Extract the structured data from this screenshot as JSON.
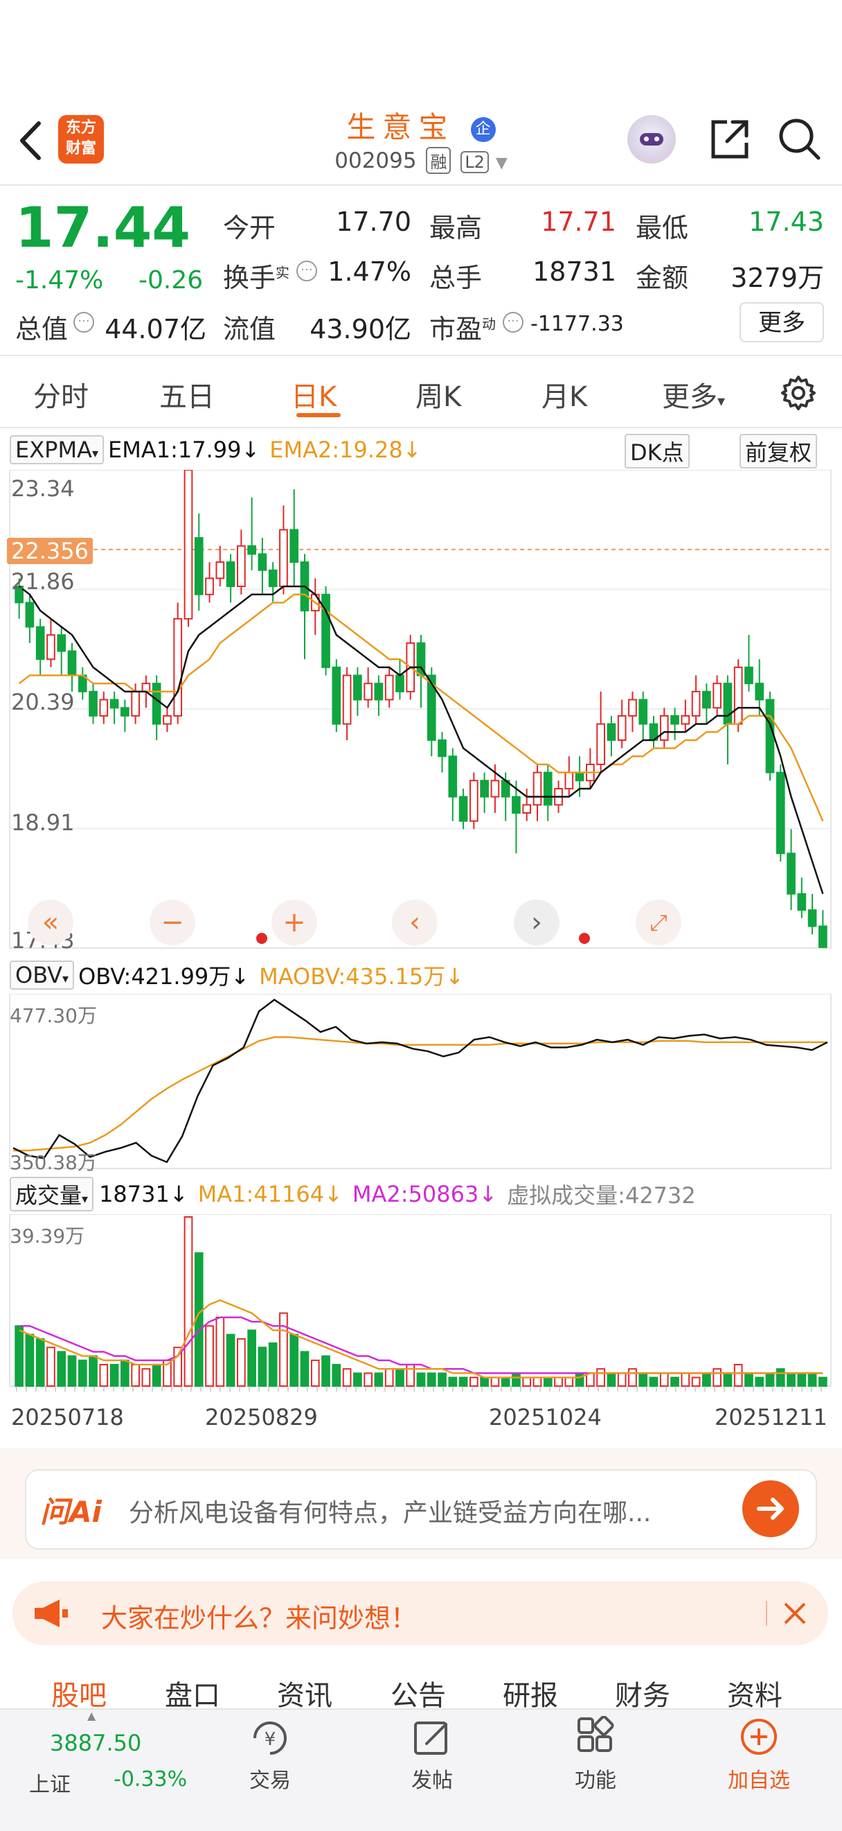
{
  "header": {
    "name": "生意宝",
    "code": "002095",
    "tags": [
      "融",
      "L2"
    ],
    "badge": "企",
    "logo_line1": "东方",
    "logo_line2": "财富"
  },
  "quote": {
    "price": "17.44",
    "change_pct": "-1.47%",
    "change": "-0.26",
    "open_label": "今开",
    "open": "17.70",
    "high_label": "最高",
    "high": "17.71",
    "low_label": "最低",
    "low": "17.43",
    "turnover_label": "换手",
    "turnover_sup": "实",
    "turnover": "1.47%",
    "volume_label": "总手",
    "volume": "18731",
    "amount_label": "金额",
    "amount": "3279万",
    "mktcap_label": "总值",
    "mktcap": "44.07亿",
    "float_label": "流值",
    "float": "43.90亿",
    "pe_label": "市盈",
    "pe_sup": "动",
    "pe": "-1177.33",
    "more": "更多"
  },
  "tabs": [
    "分时",
    "五日",
    "日K",
    "周K",
    "月K",
    "更多"
  ],
  "active_tab": "日K",
  "main_indicator": {
    "name": "EXPMA",
    "ema1": "EMA1:17.99↓",
    "ema2": "EMA2:19.28↓",
    "dk": "DK点",
    "fq": "前复权",
    "y_ticks": [
      "23.34",
      "21.86",
      "20.39",
      "18.91",
      "17.43"
    ],
    "cursor_price": "22.356"
  },
  "obv": {
    "name": "OBV",
    "obv": "OBV:421.99万↓",
    "maobv": "MAOBV:435.15万↓",
    "top": "477.30万",
    "bottom": "350.38万"
  },
  "vol": {
    "name": "成交量",
    "vol": "18731↓",
    "ma1": "MA1:41164↓",
    "ma2": "MA2:50863↓",
    "virtual": "虚拟成交量:42732",
    "top": "39.39万",
    "dates": [
      "20250718",
      "20250829",
      "20251024",
      "20251211"
    ]
  },
  "colors": {
    "up": "#e02828",
    "down": "#10a540",
    "ema1": "#111111",
    "ema2": "#e99a1e",
    "ma2": "#d22ad6",
    "accent": "#ee6a1b"
  },
  "ai": {
    "logo": "问Ai",
    "prompt": "分析风电设备有何特点，产业链受益方向在哪..."
  },
  "hot": {
    "text": "大家在炒什么？来问妙想！"
  },
  "subtabs": [
    "股吧",
    "盘口",
    "资讯",
    "公告",
    "研报",
    "财务",
    "资料"
  ],
  "index": {
    "value": "3887.50",
    "name": "上证",
    "change": "-0.33%"
  },
  "bottom_nav": [
    "交易",
    "发帖",
    "功能",
    "加自选"
  ],
  "chart_data": {
    "type": "candlestick",
    "ylim": [
      17.43,
      23.34
    ],
    "candles": [
      [
        21.9,
        21.7,
        22.0,
        21.5
      ],
      [
        21.7,
        21.4,
        21.8,
        21.2
      ],
      [
        21.4,
        21.0,
        21.5,
        20.8
      ],
      [
        21.0,
        21.3,
        21.5,
        20.9
      ],
      [
        21.3,
        21.1,
        21.4,
        20.8
      ],
      [
        21.1,
        20.8,
        21.2,
        20.6
      ],
      [
        20.8,
        20.6,
        20.9,
        20.5
      ],
      [
        20.6,
        20.3,
        20.7,
        20.2
      ],
      [
        20.3,
        20.5,
        20.6,
        20.2
      ],
      [
        20.5,
        20.4,
        20.6,
        20.2
      ],
      [
        20.4,
        20.3,
        20.5,
        20.1
      ],
      [
        20.3,
        20.6,
        20.7,
        20.2
      ],
      [
        20.6,
        20.7,
        20.8,
        20.4
      ],
      [
        20.7,
        20.2,
        20.8,
        20.0
      ],
      [
        20.2,
        20.3,
        20.4,
        20.1
      ],
      [
        20.3,
        21.5,
        21.7,
        20.2
      ],
      [
        21.5,
        23.34,
        23.34,
        21.4
      ],
      [
        22.5,
        21.8,
        22.8,
        21.6
      ],
      [
        21.8,
        22.0,
        22.2,
        21.7
      ],
      [
        22.0,
        22.2,
        22.4,
        21.9
      ],
      [
        22.2,
        21.9,
        22.3,
        21.7
      ],
      [
        21.9,
        22.4,
        22.6,
        21.8
      ],
      [
        22.4,
        22.3,
        23.0,
        22.1
      ],
      [
        22.3,
        22.1,
        22.5,
        21.8
      ],
      [
        22.1,
        21.9,
        22.2,
        21.7
      ],
      [
        21.9,
        22.6,
        22.9,
        21.8
      ],
      [
        22.6,
        22.2,
        23.1,
        21.9
      ],
      [
        22.2,
        21.6,
        22.3,
        21.0
      ],
      [
        21.6,
        21.8,
        22.0,
        21.3
      ],
      [
        21.8,
        20.9,
        21.9,
        20.8
      ],
      [
        20.9,
        20.2,
        21.0,
        20.1
      ],
      [
        20.2,
        20.8,
        20.9,
        20.0
      ],
      [
        20.8,
        20.5,
        20.9,
        20.3
      ],
      [
        20.5,
        20.7,
        20.9,
        20.4
      ],
      [
        20.7,
        20.5,
        20.8,
        20.3
      ],
      [
        20.5,
        20.8,
        20.9,
        20.4
      ],
      [
        20.8,
        20.6,
        21.0,
        20.5
      ],
      [
        20.6,
        21.2,
        21.3,
        20.5
      ],
      [
        21.2,
        20.8,
        21.3,
        20.4
      ],
      [
        20.8,
        20.0,
        20.9,
        19.8
      ],
      [
        20.0,
        19.8,
        20.1,
        19.6
      ],
      [
        19.8,
        19.3,
        19.9,
        19.0
      ],
      [
        19.3,
        19.0,
        19.4,
        18.9
      ],
      [
        19.0,
        19.5,
        19.6,
        18.9
      ],
      [
        19.5,
        19.3,
        19.6,
        19.1
      ],
      [
        19.3,
        19.5,
        19.7,
        19.1
      ],
      [
        19.5,
        19.3,
        19.6,
        19.0
      ],
      [
        19.3,
        19.1,
        19.5,
        18.6
      ],
      [
        19.1,
        19.2,
        19.4,
        19.0
      ],
      [
        19.2,
        19.6,
        19.7,
        19.0
      ],
      [
        19.6,
        19.2,
        19.7,
        19.0
      ],
      [
        19.2,
        19.4,
        19.5,
        19.1
      ],
      [
        19.4,
        19.6,
        19.8,
        19.3
      ],
      [
        19.6,
        19.5,
        19.8,
        19.3
      ],
      [
        19.5,
        19.7,
        19.9,
        19.4
      ],
      [
        19.7,
        20.2,
        20.6,
        19.6
      ],
      [
        20.2,
        20.0,
        20.3,
        19.8
      ],
      [
        20.0,
        20.3,
        20.5,
        19.9
      ],
      [
        20.3,
        20.5,
        20.6,
        20.1
      ],
      [
        20.5,
        20.2,
        20.6,
        20.0
      ],
      [
        20.2,
        20.0,
        20.3,
        19.9
      ],
      [
        20.0,
        20.3,
        20.4,
        19.9
      ],
      [
        20.3,
        20.2,
        20.4,
        20.0
      ],
      [
        20.2,
        20.3,
        20.5,
        20.1
      ],
      [
        20.3,
        20.6,
        20.8,
        20.2
      ],
      [
        20.6,
        20.4,
        20.7,
        20.2
      ],
      [
        20.4,
        20.7,
        20.8,
        20.3
      ],
      [
        20.7,
        20.2,
        20.8,
        19.7
      ],
      [
        20.2,
        20.9,
        21.0,
        20.1
      ],
      [
        20.9,
        20.7,
        21.3,
        20.6
      ],
      [
        20.7,
        20.5,
        21.0,
        20.3
      ],
      [
        20.5,
        19.6,
        20.6,
        19.5
      ],
      [
        19.6,
        18.6,
        19.7,
        18.5
      ],
      [
        18.6,
        18.1,
        18.9,
        17.9
      ],
      [
        18.1,
        17.9,
        18.3,
        17.8
      ],
      [
        17.9,
        17.7,
        18.1,
        17.6
      ],
      [
        17.7,
        17.44,
        17.9,
        17.43
      ]
    ],
    "ema1": [
      21.9,
      21.8,
      21.6,
      21.5,
      21.4,
      21.3,
      21.1,
      20.9,
      20.8,
      20.7,
      20.6,
      20.6,
      20.6,
      20.5,
      20.4,
      20.6,
      21.1,
      21.3,
      21.4,
      21.5,
      21.6,
      21.7,
      21.8,
      21.8,
      21.8,
      21.9,
      21.9,
      21.9,
      21.8,
      21.6,
      21.3,
      21.2,
      21.1,
      21.0,
      20.9,
      20.9,
      20.8,
      20.9,
      20.9,
      20.7,
      20.5,
      20.2,
      19.9,
      19.8,
      19.7,
      19.6,
      19.5,
      19.4,
      19.3,
      19.3,
      19.3,
      19.3,
      19.3,
      19.4,
      19.4,
      19.6,
      19.7,
      19.8,
      19.9,
      20.0,
      20.0,
      20.1,
      20.1,
      20.1,
      20.2,
      20.2,
      20.3,
      20.3,
      20.4,
      20.4,
      20.4,
      20.2,
      19.8,
      19.3,
      18.9,
      18.5,
      18.1
    ],
    "ema2": [
      20.7,
      20.8,
      20.8,
      20.8,
      20.8,
      20.8,
      20.8,
      20.7,
      20.7,
      20.7,
      20.7,
      20.6,
      20.6,
      20.6,
      20.6,
      20.6,
      20.8,
      20.9,
      21.0,
      21.2,
      21.3,
      21.4,
      21.5,
      21.6,
      21.7,
      21.7,
      21.8,
      21.8,
      21.7,
      21.6,
      21.5,
      21.4,
      21.3,
      21.2,
      21.1,
      21.0,
      21.0,
      20.9,
      20.8,
      20.7,
      20.6,
      20.5,
      20.4,
      20.3,
      20.2,
      20.1,
      20.0,
      19.9,
      19.8,
      19.7,
      19.7,
      19.6,
      19.6,
      19.6,
      19.6,
      19.6,
      19.7,
      19.7,
      19.8,
      19.8,
      19.9,
      19.9,
      19.9,
      20.0,
      20.0,
      20.1,
      20.1,
      20.2,
      20.2,
      20.3,
      20.3,
      20.3,
      20.1,
      19.9,
      19.6,
      19.3,
      19.0
    ],
    "obv_values": [
      362,
      356,
      354,
      372,
      365,
      355,
      359,
      362,
      366,
      356,
      351,
      371,
      402,
      426,
      432,
      440,
      468,
      477,
      469,
      461,
      452,
      456,
      446,
      443,
      444,
      443,
      439,
      437,
      433,
      436,
      446,
      448,
      444,
      441,
      444,
      440,
      440,
      442,
      446,
      444,
      446,
      442,
      448,
      447,
      449,
      450,
      447,
      448,
      446,
      442,
      441,
      440,
      438,
      444
    ],
    "maobv_values": [
      360,
      360,
      361,
      362,
      363,
      366,
      372,
      380,
      390,
      400,
      408,
      415,
      421,
      427,
      433,
      439,
      445,
      448,
      448,
      447,
      446,
      445,
      444,
      443,
      443,
      442,
      442,
      442,
      442,
      442,
      442,
      442,
      443,
      443,
      443,
      443,
      443,
      443,
      444,
      444,
      444,
      444,
      445,
      445,
      445,
      444,
      444,
      444,
      444,
      444,
      444,
      444,
      444,
      444
    ],
    "volume_wan": [
      14,
      12,
      11,
      9,
      8,
      7,
      6,
      7,
      5,
      5,
      6,
      5,
      4,
      5,
      6,
      9,
      39.39,
      31,
      14,
      16,
      12,
      11,
      13,
      9,
      10,
      17,
      12,
      8,
      6,
      7,
      5,
      4,
      3,
      3,
      3,
      4,
      4,
      5,
      3,
      3,
      3,
      2,
      2,
      2,
      2,
      2,
      2,
      3,
      2,
      2,
      2,
      2,
      2,
      3,
      3,
      4,
      3,
      3,
      4,
      3,
      2,
      3,
      2,
      3,
      2,
      3,
      4,
      3,
      5,
      3,
      2,
      3,
      4,
      3,
      3,
      3,
      2
    ],
    "ma1_wan": [
      13,
      12,
      11,
      10,
      9,
      8,
      7,
      7,
      6,
      6,
      6,
      5,
      5,
      5,
      5,
      7,
      12,
      17,
      19,
      20,
      19,
      18,
      17,
      15,
      13,
      13,
      12,
      11,
      10,
      9,
      8,
      7,
      6,
      5,
      4,
      4,
      4,
      4,
      4,
      4,
      4,
      3,
      3,
      3,
      2,
      2,
      2,
      2,
      2,
      2,
      2,
      2,
      2,
      2,
      3,
      3,
      3,
      3,
      3,
      3,
      3,
      3,
      3,
      3,
      3,
      3,
      3,
      3,
      3,
      3,
      3,
      3,
      3,
      3,
      3,
      3,
      3
    ],
    "ma2_wan": [
      14,
      14,
      13,
      12,
      11,
      10,
      9,
      8,
      8,
      7,
      7,
      6,
      6,
      6,
      6,
      7,
      10,
      13,
      15,
      16,
      16,
      16,
      15,
      15,
      14,
      14,
      13,
      12,
      11,
      10,
      9,
      8,
      7,
      7,
      6,
      6,
      5,
      5,
      5,
      4,
      4,
      4,
      4,
      3,
      3,
      3,
      3,
      3,
      3,
      3,
      3,
      3,
      3,
      3,
      3,
      3,
      3,
      3,
      3,
      3,
      3,
      3,
      3,
      3,
      3,
      3,
      3,
      3,
      3,
      3,
      3,
      3,
      3,
      3,
      3,
      3,
      3
    ]
  }
}
